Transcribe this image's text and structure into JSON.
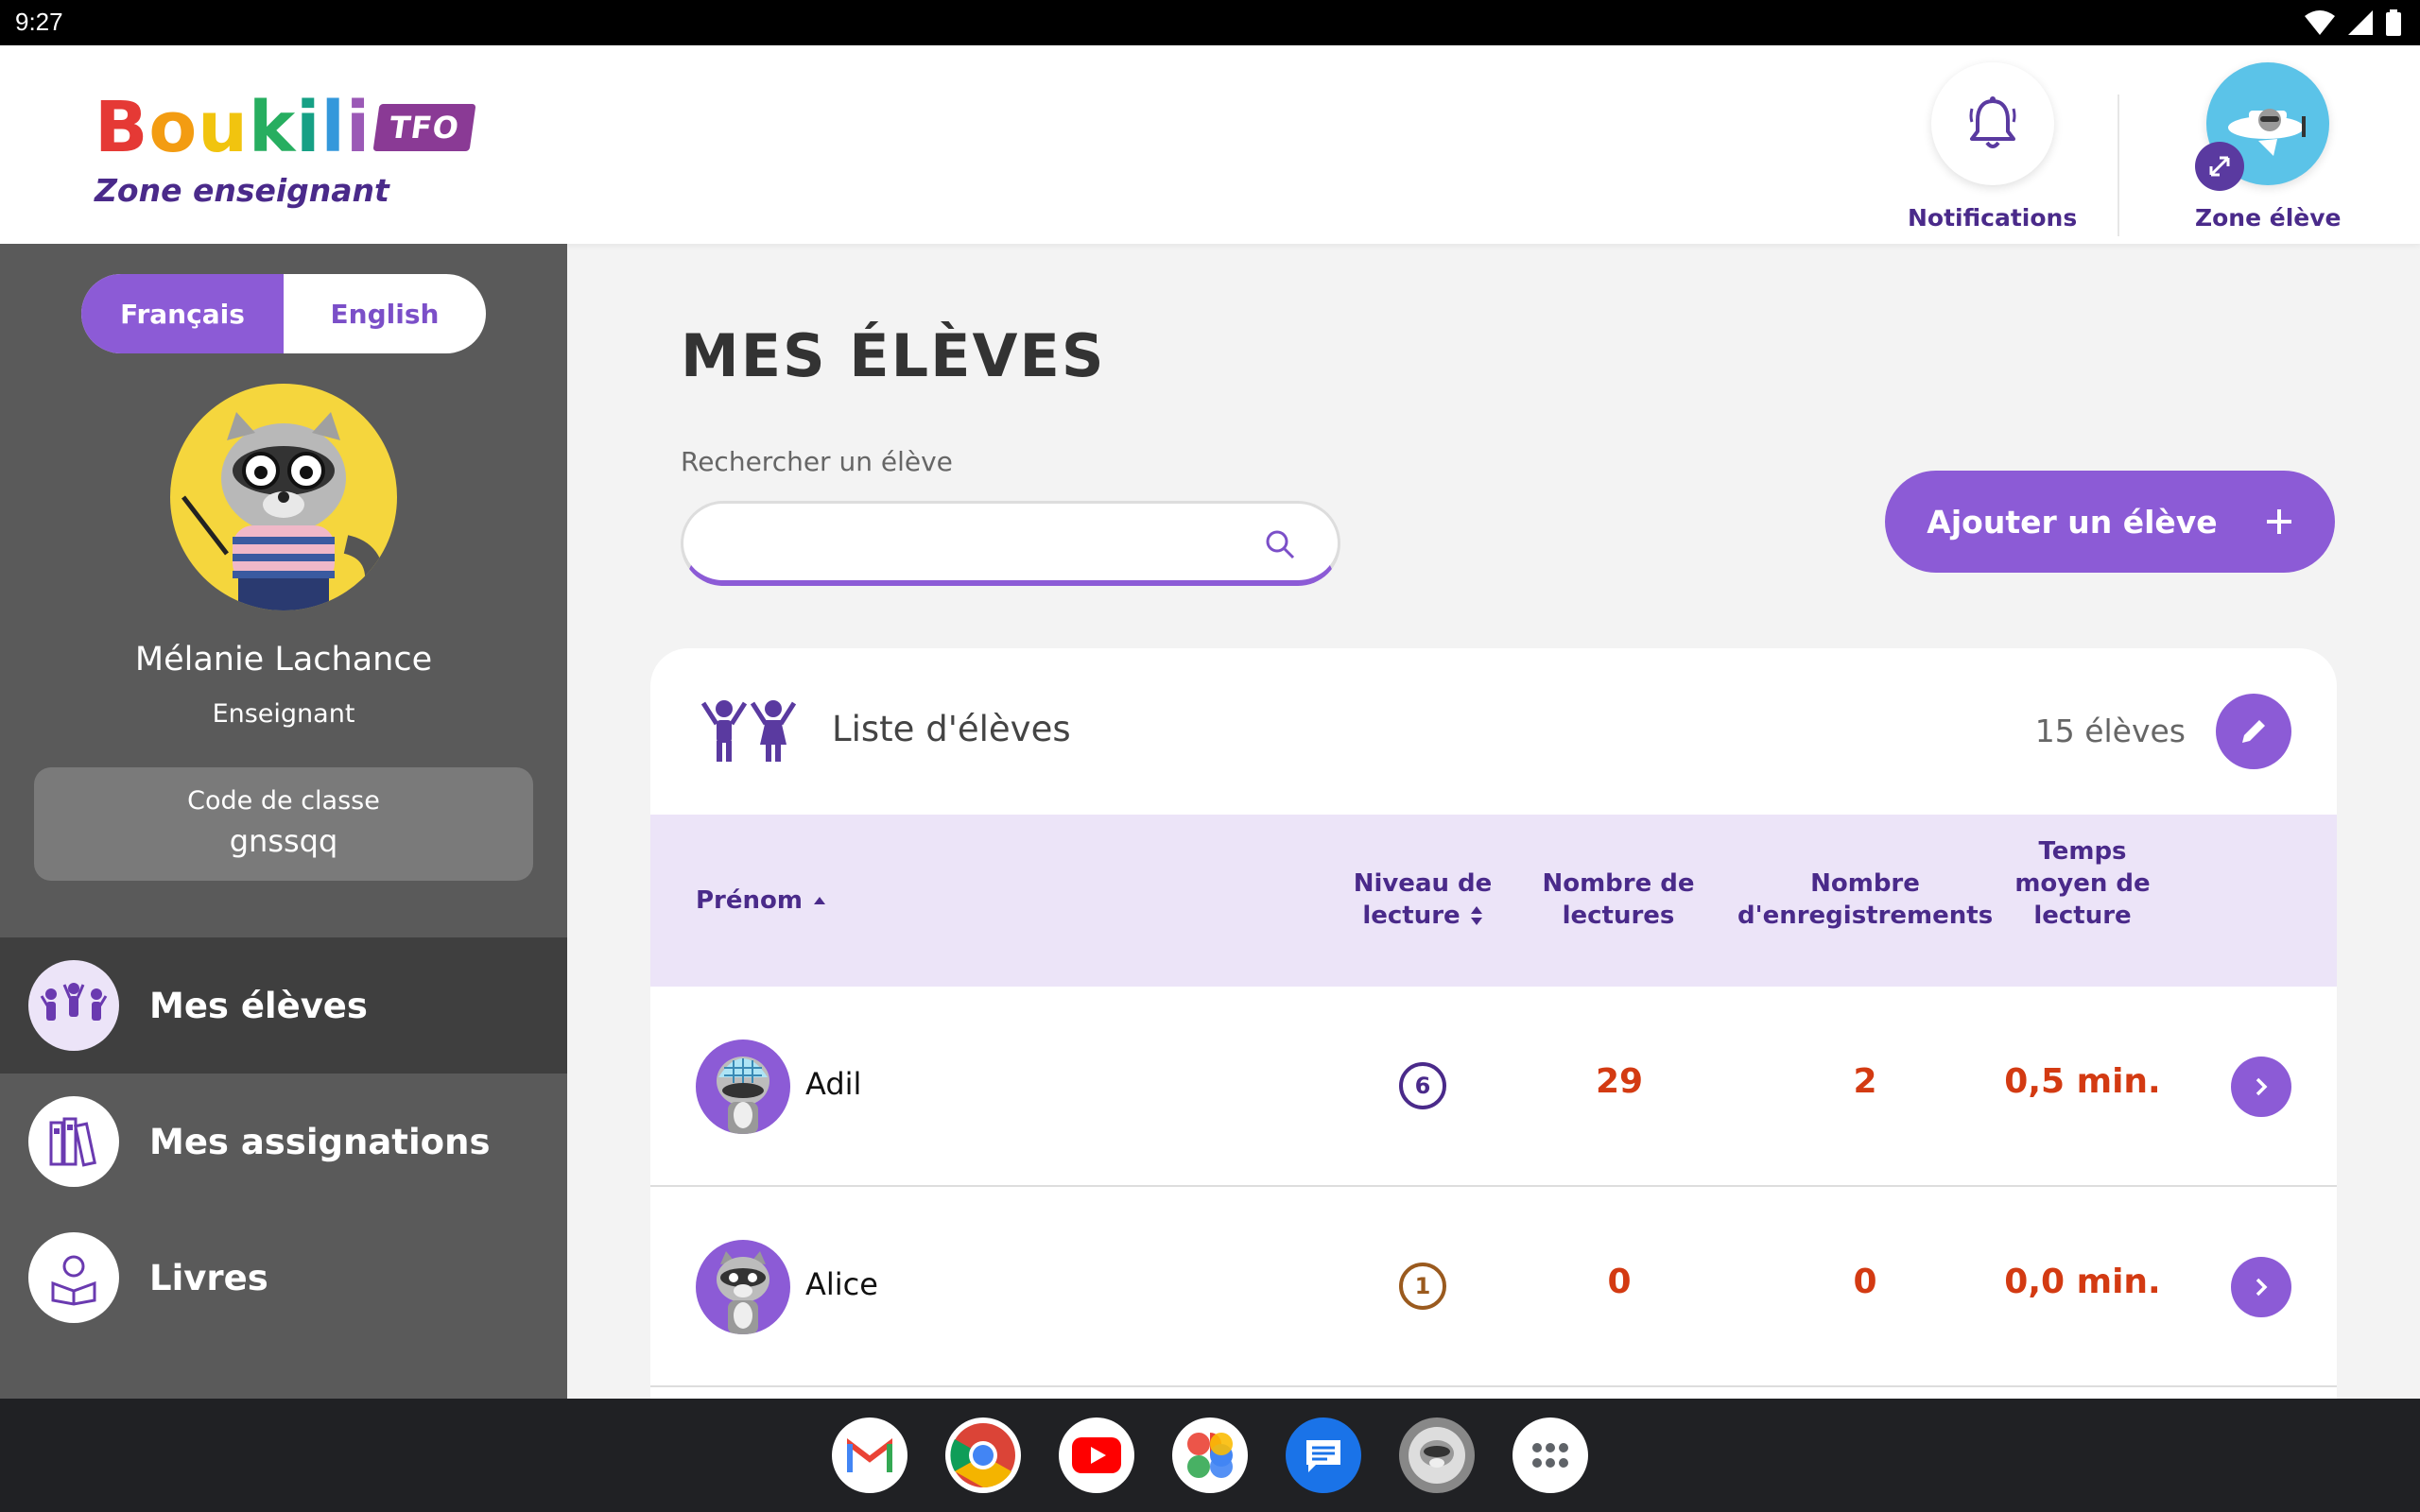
{
  "status_bar": {
    "time": "9:27"
  },
  "header": {
    "logo": {
      "letters": [
        "B",
        "o",
        "u",
        "k",
        "i",
        "l",
        "i"
      ],
      "letter_colors": [
        "#e53935",
        "#f39c12",
        "#f1c40f",
        "#27ae60",
        "#16a085",
        "#3498db",
        "#9b59b6"
      ],
      "badge": "TFO",
      "subtitle": "Zone enseignant"
    },
    "notifications_label": "Notifications",
    "student_zone_label": "Zone élève"
  },
  "sidebar": {
    "lang": {
      "fr": "Français",
      "en": "English",
      "active": "fr"
    },
    "teacher_name": "Mélanie Lachance",
    "teacher_role": "Enseignant",
    "class_code_label": "Code de classe",
    "class_code_value": "gnssqq",
    "nav": [
      {
        "label": "Mes élèves",
        "icon": "students-icon",
        "active": true
      },
      {
        "label": "Mes assignations",
        "icon": "books-icon",
        "active": false
      },
      {
        "label": "Livres",
        "icon": "reader-icon",
        "active": false
      }
    ]
  },
  "main": {
    "title": "MES ÉLÈVES",
    "search_label": "Rechercher un élève",
    "search_value": "",
    "add_button": "Ajouter un élève",
    "list_title": "Liste d'élèves",
    "list_count": "15 élèves",
    "columns": {
      "first_name": "Prénom",
      "level": [
        "Niveau de",
        "lecture"
      ],
      "reads": [
        "Nombre de",
        "lectures"
      ],
      "recordings": [
        "Nombre",
        "d'enregistrements"
      ],
      "avg_time": [
        "Temps",
        "moyen de",
        "lecture"
      ]
    },
    "rows": [
      {
        "name": "Adil",
        "level": "6",
        "reads": "29",
        "recordings": "2",
        "avg_time": "0,5 min."
      },
      {
        "name": "Alice",
        "level": "1",
        "reads": "0",
        "recordings": "0",
        "avg_time": "0,0 min."
      }
    ]
  },
  "colors": {
    "accent": "#8c5bd6",
    "dark_purple": "#4a2a8a",
    "value_red": "#d33a12",
    "sidebar": "#5a5a5a"
  },
  "taskbar": {
    "apps": [
      "gmail-icon",
      "chrome-icon",
      "youtube-icon",
      "photos-icon",
      "messages-icon",
      "boukili-icon",
      "app-drawer-icon"
    ]
  }
}
